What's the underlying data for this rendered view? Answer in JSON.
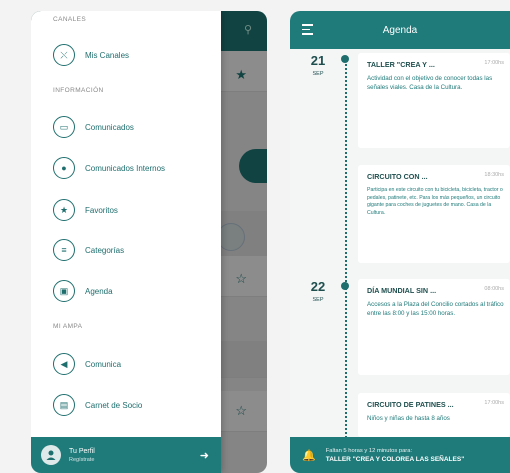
{
  "left_app": {
    "drawer": {
      "sections": {
        "canales": "CANALES",
        "informacion": "INFORMACIÓN",
        "mi_ampa": "MI AMPA"
      },
      "items": {
        "mis_canales": "Mis Canales",
        "comunicados": "Comunicados",
        "comunicados_internos": "Comunicados Internos",
        "favoritos": "Favoritos",
        "categorias": "Categorías",
        "agenda": "Agenda",
        "comunica": "Comunica",
        "carnet_socio": "Carnet de Socio"
      },
      "footer": {
        "name": "Tu Perfil",
        "sub": "Regístrate"
      }
    }
  },
  "right_app": {
    "header_title": "Agenda",
    "days": [
      {
        "num": "21",
        "month": "SEP"
      },
      {
        "num": "22",
        "month": "SEP"
      }
    ],
    "events": [
      {
        "title": "TALLER \"CREA Y ...",
        "time": "17:00hs",
        "desc": "Actividad con el objetivo de conocer todas las señales viales. Casa de la Cultura."
      },
      {
        "title": "CIRCUITO CON ...",
        "time": "18:30hs",
        "desc": "Participa en este circuito con tu bicicleta, bicicleta, tractor o pedales, patinete, etc. Para los más pequeños, un circuito gigante para coches de juguetes de mano. Casa de la Cultura."
      },
      {
        "title": "DÍA MUNDIAL SIN ...",
        "time": "08:00hs",
        "desc": "Accesos a la Plaza del Concilio cortados al tráfico entre las 8:00 y las 15:00 horas."
      },
      {
        "title": "CIRCUITO DE PATINES ...",
        "time": "17:00hs",
        "desc": "Niños y niñas de hasta 8 años"
      }
    ],
    "footer": {
      "sub": "Faltan 5 horas y 12 minutos para:",
      "main": "TALLER \"CREA Y COLOREA LAS SEÑALES\""
    }
  },
  "colors": {
    "primary": "#1f7a7a",
    "text_dark": "#1f4e4e"
  }
}
